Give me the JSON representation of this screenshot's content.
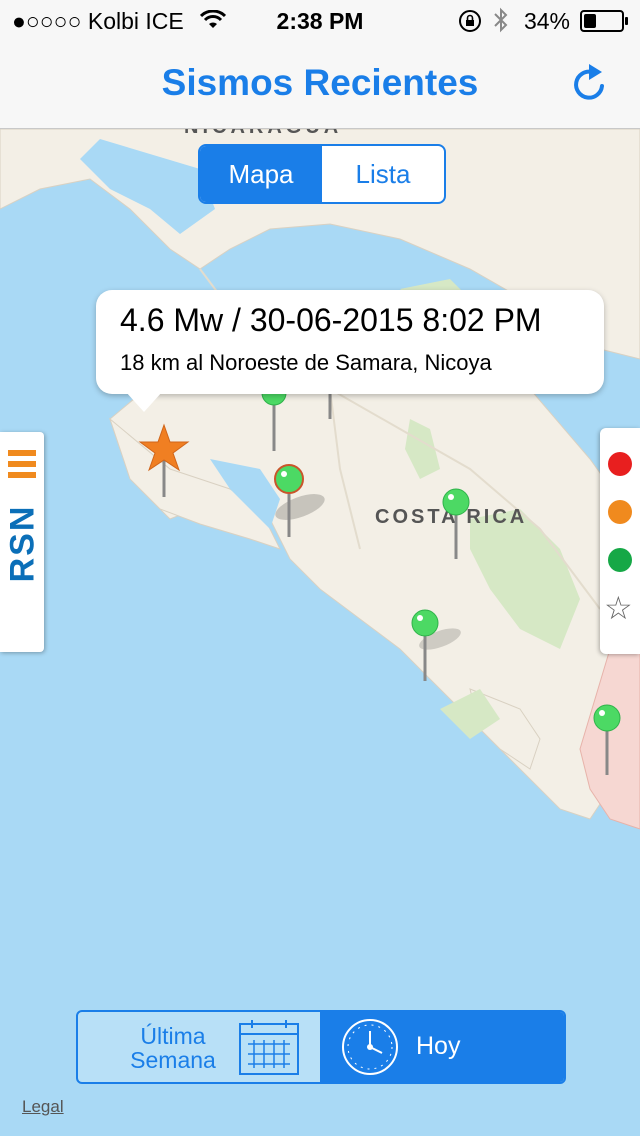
{
  "status_bar": {
    "carrier": "●○○○○ Kolbi ICE",
    "time": "2:38 PM",
    "battery_percent": "34%",
    "battery_level": 0.34,
    "icons": [
      "wifi-icon",
      "orientation-lock-icon",
      "bluetooth-icon",
      "battery-icon"
    ]
  },
  "nav": {
    "title": "Sismos Recientes",
    "refresh_icon": "refresh-icon"
  },
  "view_toggle": {
    "options": [
      "Mapa",
      "Lista"
    ],
    "selected": "Mapa"
  },
  "map": {
    "labels": {
      "country_north": "NICARAGUA",
      "country_main": "COSTA RICA"
    },
    "callout": {
      "title": "4.6 Mw / 30-06-2015 8:02 PM",
      "subtitle": "18 km al Noroeste de Samara, Nicoya"
    },
    "markers": [
      {
        "type": "star",
        "color": "#f07f22",
        "icon": "star-marker-icon"
      },
      {
        "type": "pin",
        "color": "#4cd964",
        "icon": "green-pin-icon"
      },
      {
        "type": "pin",
        "color": "#4cd964",
        "icon": "green-pin-icon"
      },
      {
        "type": "pin",
        "color": "#4cd964",
        "icon": "green-pin-icon"
      },
      {
        "type": "pin",
        "color": "#4cd964",
        "icon": "green-pin-icon"
      },
      {
        "type": "pin",
        "color": "#4cd964",
        "icon": "green-pin-icon"
      },
      {
        "type": "pin",
        "color": "#4cd964",
        "icon": "green-pin-icon"
      }
    ],
    "colors": {
      "water": "#a9d9f5",
      "land": "#f3efe6",
      "park": "#d6e8c5",
      "neighbor": "#f6d7d2"
    }
  },
  "rsn_logo": {
    "text": "RSN",
    "color": "#0b6fb8",
    "accent": "#f08a1e"
  },
  "legend": {
    "items": [
      {
        "color": "#e81f1f",
        "icon": "red-dot-icon"
      },
      {
        "color": "#f08a1e",
        "icon": "orange-dot-icon"
      },
      {
        "color": "#16a846",
        "icon": "green-dot-icon"
      },
      {
        "icon": "star-outline-icon"
      }
    ]
  },
  "time_filter": {
    "week_label_line1": "Última",
    "week_label_line2": "Semana",
    "week_icon": "calendar-icon",
    "today_label": "Hoy",
    "today_icon": "clock-icon",
    "selected": "Hoy"
  },
  "legal": "Legal",
  "accent": "#1a7ee8"
}
